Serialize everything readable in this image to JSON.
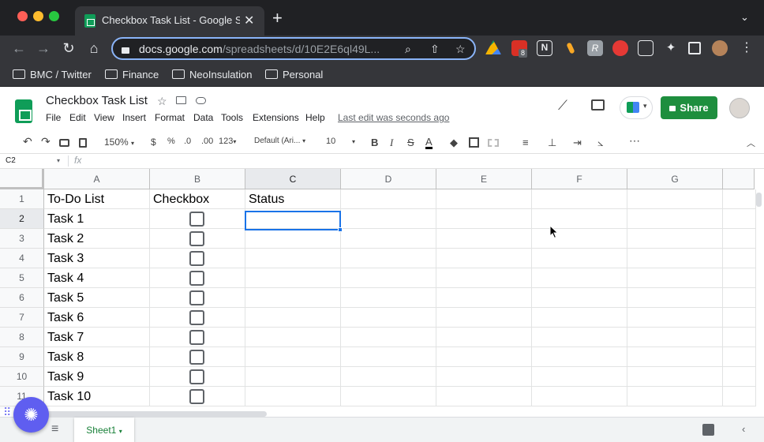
{
  "browser": {
    "tab_title": "Checkbox Task List - Google Sheets",
    "url_host": "docs.google.com",
    "url_path": "/spreadsheets/d/10E2E6ql49L...",
    "ext_badge": "8",
    "bookmarks": [
      "BMC / Twitter",
      "Finance",
      "NeoInsulation",
      "Personal"
    ]
  },
  "doc": {
    "title": "Checkbox Task List",
    "menus": [
      "File",
      "Edit",
      "View",
      "Insert",
      "Format",
      "Data",
      "Tools",
      "Extensions",
      "Help"
    ],
    "last_edit": "Last edit was seconds ago",
    "share_label": "Share"
  },
  "toolbar": {
    "zoom": "150%",
    "currency": "$",
    "percent": "%",
    "dec_less": ".0",
    "dec_more": ".00",
    "more_formats": "123",
    "font": "Default (Ari...",
    "font_size": "10",
    "bold": "B",
    "italic": "I",
    "strike": "S",
    "text_color": "A",
    "more": "⋯"
  },
  "formula_bar": {
    "name_box": "C2",
    "fx": "fx"
  },
  "grid": {
    "columns": [
      "A",
      "B",
      "C",
      "D",
      "E",
      "F",
      "G"
    ],
    "rows": [
      "1",
      "2",
      "3",
      "4",
      "5",
      "6",
      "7",
      "8",
      "9",
      "10",
      "11"
    ],
    "headers": {
      "a": "To-Do List",
      "b": "Checkbox",
      "c": "Status"
    },
    "tasks": [
      "Task 1",
      "Task 2",
      "Task 3",
      "Task 4",
      "Task 5",
      "Task 6",
      "Task 7",
      "Task 8",
      "Task 9",
      "Task 10"
    ],
    "selected_cell": "C2"
  },
  "sheets": {
    "add": "+",
    "list": "≡",
    "active": "Sheet1"
  },
  "colors": {
    "accent": "#1a73e8",
    "share": "#1e8e3e",
    "sheet_tab": "#188038"
  }
}
